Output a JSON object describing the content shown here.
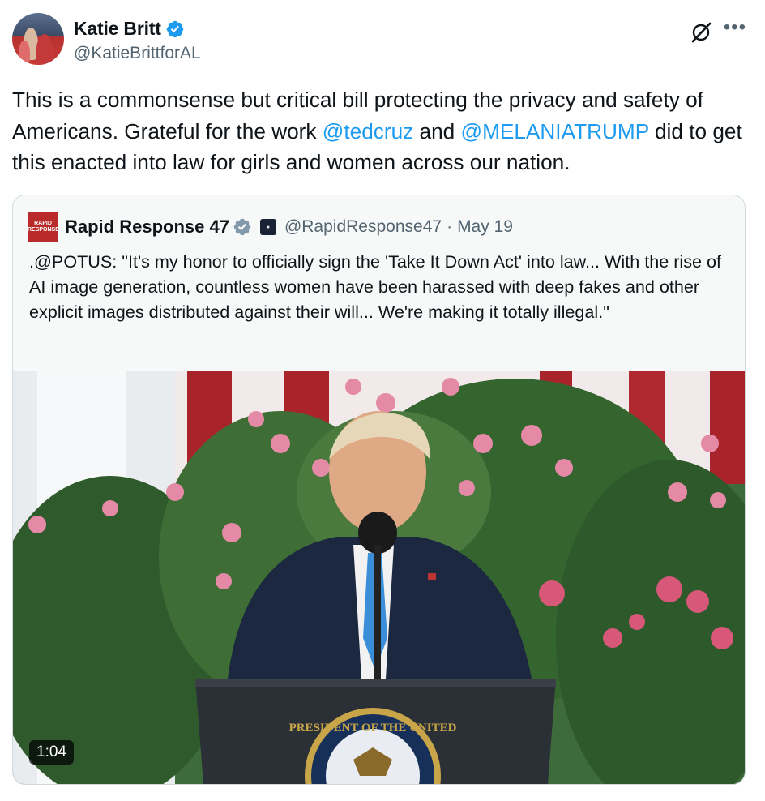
{
  "author": {
    "name": "Katie Britt",
    "handle": "@KatieBrittforAL"
  },
  "tweet": {
    "text_part1": "This is a commonsense but critical bill protecting the privacy and safety of Americans. Grateful for the work ",
    "mention1": "@tedcruz",
    "text_part2": " and ",
    "mention2": "@MELANIATRUMP",
    "text_part3": " did to get this enacted into law for girls and women across our nation."
  },
  "quoted": {
    "avatar_text_line1": "RAPID",
    "avatar_text_line2": "RESPONSE",
    "name": "Rapid Response 47",
    "handle": "@RapidResponse47",
    "separator": "·",
    "date": "May 19",
    "text": ".@POTUS: \"It's my honor to officially sign the 'Take It Down Act' into law... With the rise of AI image generation, countless women have been harassed with deep fakes and other explicit images distributed against their will... We're making it totally illegal.\"",
    "media": {
      "duration": "1:04",
      "seal_text": "PRESIDENT OF THE UNITED"
    }
  },
  "icons": {
    "verified": "verified-badge-icon",
    "grok": "grok-icon",
    "more": "more-options-icon"
  },
  "colors": {
    "accent": "#1d9bf0",
    "text": "#0f1419",
    "secondary": "#536471",
    "border": "#cfd9de",
    "verified_gold_gray": "#829aab"
  }
}
